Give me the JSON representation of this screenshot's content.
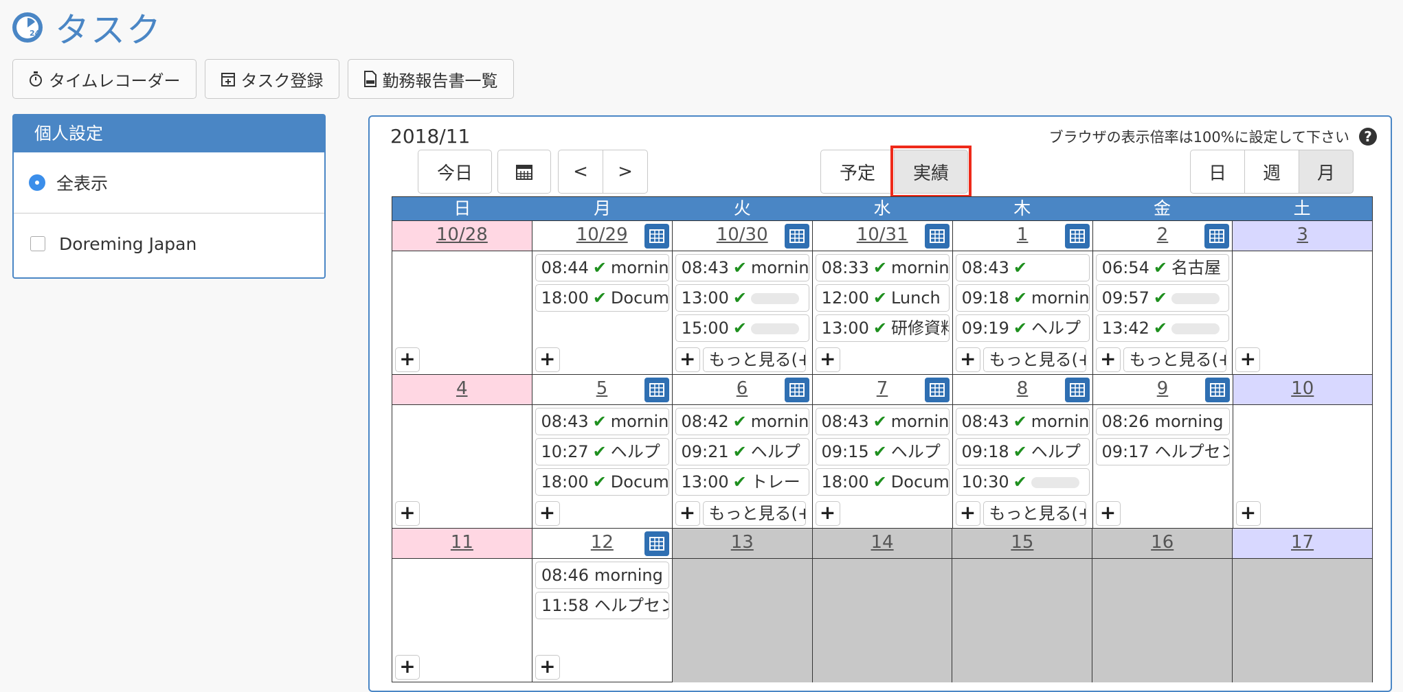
{
  "page": {
    "title": "タスク"
  },
  "toolbar": {
    "time_recorder": "タイムレコーダー",
    "task_register": "タスク登録",
    "report_list": "勤務報告書一覧"
  },
  "sidebar": {
    "header": "個人設定",
    "options": [
      {
        "label": "全表示",
        "selected": true
      },
      {
        "label": "Doreming Japan",
        "selected": false
      }
    ]
  },
  "calendar": {
    "month": "2018/11",
    "zoom_note": "ブラウザの表示倍率は100%に設定して下さい",
    "help": "?",
    "nav": {
      "today": "今日",
      "prev": "<",
      "next": ">"
    },
    "mode": {
      "plan": "予定",
      "actual": "実績"
    },
    "views": {
      "day": "日",
      "week": "週",
      "month": "月"
    },
    "plus": "+",
    "check": "✔",
    "weekdays": [
      "日",
      "月",
      "火",
      "水",
      "木",
      "金",
      "土"
    ],
    "weeks": [
      [
        {
          "date": "10/28",
          "events": []
        },
        {
          "date": "10/29",
          "events": [
            {
              "time": "08:44",
              "text": "mornin"
            },
            {
              "time": "18:00",
              "text": "Docum"
            }
          ]
        },
        {
          "date": "10/30",
          "events": [
            {
              "time": "08:43",
              "text": "mornin"
            },
            {
              "time": "13:00",
              "text": ""
            },
            {
              "time": "15:00",
              "text": ""
            }
          ],
          "more": "もっと見る(+"
        },
        {
          "date": "10/31",
          "events": [
            {
              "time": "08:33",
              "text": "mornin"
            },
            {
              "time": "12:00",
              "text": "Lunch"
            },
            {
              "time": "13:00",
              "text": "研修資料"
            }
          ]
        },
        {
          "date": "1",
          "events": [
            {
              "time": "08:43",
              "text": ""
            },
            {
              "time": "09:18",
              "text": "mornin"
            },
            {
              "time": "09:19",
              "text": "ヘルプ"
            }
          ],
          "more": "もっと見る(+"
        },
        {
          "date": "2",
          "events": [
            {
              "time": "06:54",
              "text": "名古屋"
            },
            {
              "time": "09:57",
              "text": ""
            },
            {
              "time": "13:42",
              "text": ""
            }
          ],
          "more": "もっと見る(+"
        },
        {
          "date": "3",
          "events": []
        }
      ],
      [
        {
          "date": "4",
          "events": []
        },
        {
          "date": "5",
          "events": [
            {
              "time": "08:43",
              "text": "mornin"
            },
            {
              "time": "10:27",
              "text": "ヘルプ"
            },
            {
              "time": "18:00",
              "text": "Docum"
            }
          ]
        },
        {
          "date": "6",
          "events": [
            {
              "time": "08:42",
              "text": "mornin"
            },
            {
              "time": "09:21",
              "text": "ヘルプ"
            },
            {
              "time": "13:00",
              "text": "トレー"
            }
          ],
          "more": "もっと見る(+"
        },
        {
          "date": "7",
          "events": [
            {
              "time": "08:43",
              "text": "mornin"
            },
            {
              "time": "09:15",
              "text": "ヘルプ"
            },
            {
              "time": "18:00",
              "text": "Docum"
            }
          ]
        },
        {
          "date": "8",
          "events": [
            {
              "time": "08:43",
              "text": "mornin"
            },
            {
              "time": "09:18",
              "text": "ヘルプ"
            },
            {
              "time": "10:30",
              "text": ""
            }
          ],
          "more": "もっと見る(+"
        },
        {
          "date": "9",
          "events": [
            {
              "time": "08:26",
              "text": "morning r",
              "nocheck": true
            },
            {
              "time": "09:17",
              "text": "ヘルプセン",
              "nocheck": true
            }
          ]
        },
        {
          "date": "10",
          "events": []
        }
      ],
      [
        {
          "date": "11",
          "events": []
        },
        {
          "date": "12",
          "events": [
            {
              "time": "08:46",
              "text": "morning r",
              "nocheck": true
            },
            {
              "time": "11:58",
              "text": "ヘルプセン",
              "nocheck": true
            }
          ]
        },
        {
          "date": "13",
          "events": []
        },
        {
          "date": "14",
          "events": []
        },
        {
          "date": "15",
          "events": []
        },
        {
          "date": "16",
          "events": []
        },
        {
          "date": "17",
          "events": []
        }
      ]
    ]
  }
}
